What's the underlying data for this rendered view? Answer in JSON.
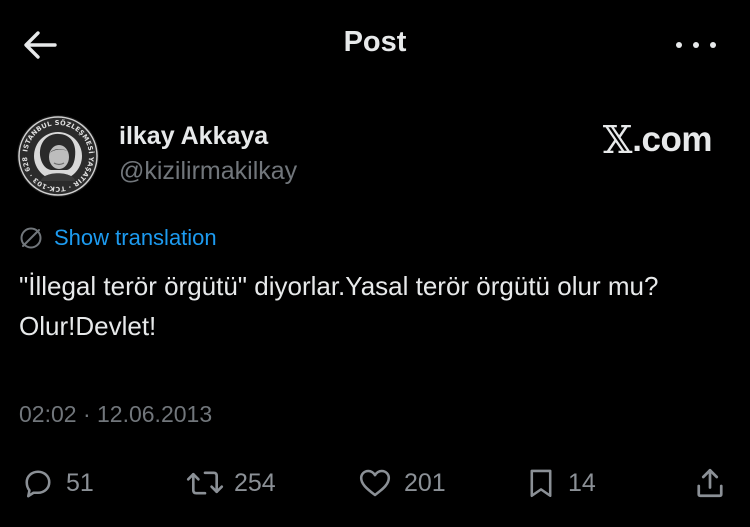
{
  "header": {
    "title": "Post"
  },
  "author": {
    "name": "ilkay Akkaya",
    "handle": "@kizilirmakilkay",
    "avatar_ring_text": "ISTANBUL SÖZLEŞMESİ YAŞATIR · TCK-103 · 6284'Ü UYGULA"
  },
  "brand": {
    "mark": "𝕏",
    "text": ".com"
  },
  "translation": {
    "label": "Show translation"
  },
  "tweet": {
    "text": "\"İllegal terör örgütü\" diyorlar.Yasal terör örgütü olur mu?Olur!Devlet!"
  },
  "meta": {
    "timestamp": "02:02 · 12.06.2013"
  },
  "actions": {
    "replies": "51",
    "reposts": "254",
    "likes": "201",
    "bookmarks": "14"
  },
  "colors": {
    "background": "#000000",
    "text": "#e7e9ea",
    "muted": "#71767b",
    "link": "#1d9bf0"
  }
}
